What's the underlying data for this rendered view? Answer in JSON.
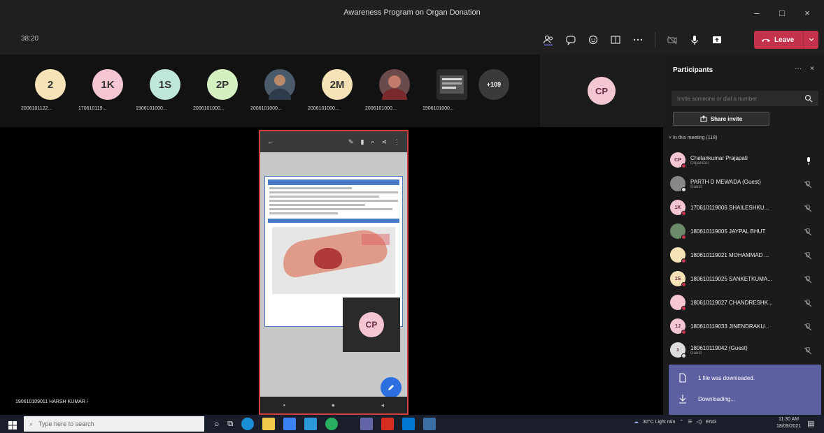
{
  "window": {
    "title": "Awareness Program on Organ Donation",
    "minimize": "–",
    "maximize": "□",
    "close": "×"
  },
  "toolbar": {
    "timer": "38:20",
    "leave_label": "Leave"
  },
  "strip": {
    "tiles": [
      {
        "initials": "2",
        "name": "2006101122...",
        "color": "#f5e2b6"
      },
      {
        "initials": "1K",
        "name": "170610119...",
        "color": "#f4c6d2"
      },
      {
        "initials": "1S",
        "name": "1906101000...",
        "color": "#bfe7d7"
      },
      {
        "initials": "2P",
        "name": "2006101000...",
        "color": "#d4f0c0"
      },
      {
        "initials": "",
        "name": "2006101000...",
        "color": "#4a5a6a"
      },
      {
        "initials": "2M",
        "name": "2006101000...",
        "color": "#f5e2b6"
      },
      {
        "initials": "",
        "name": "2006101000...",
        "color": "#6a4a4a"
      },
      {
        "initials": "",
        "name": "1906101000...",
        "color": "#2a2a2a"
      }
    ],
    "more": "+109",
    "presenter_initials": "CP"
  },
  "stage": {
    "self_initials": "CP",
    "speaker_name": "190610109011 HARSH KUMAR"
  },
  "panel": {
    "title": "Participants",
    "more": "···",
    "close": "×",
    "invite_placeholder": "Invite someone or dial a number",
    "share_label": "Share invite",
    "section_label": "In this meeting (118)",
    "participants": [
      {
        "name": "Chetankumar Prajapati",
        "role": "Organizer",
        "color": "#f4c6d2",
        "initials": "CP"
      },
      {
        "name": "PARTH D MEWADA (Guest)",
        "role": "Guest",
        "color": "#888888",
        "initials": ""
      },
      {
        "name": "170610119006 SHAILESHKU...",
        "role": "",
        "color": "#f4c6d2",
        "initials": "1K"
      },
      {
        "name": "180610119005 JAYPAL BHUT",
        "role": "",
        "color": "#6a8a6a",
        "initials": ""
      },
      {
        "name": "180610119021 MOHAMMAD ...",
        "role": "",
        "color": "#f5e2b6",
        "initials": ""
      },
      {
        "name": "180610119025 SANKETKUMA...",
        "role": "",
        "color": "#f5e2b6",
        "initials": "1S"
      },
      {
        "name": "180610119027 CHANDRESHK...",
        "role": "",
        "color": "#f4c6d2",
        "initials": ""
      },
      {
        "name": "180610119033 JINENDRAKU...",
        "role": "",
        "color": "#f4c6d2",
        "initials": "1J"
      },
      {
        "name": "180610119042 (Guest)",
        "role": "Guest",
        "color": "#dddddd",
        "initials": "1"
      }
    ]
  },
  "toast": {
    "line1": "1 file was downloaded.",
    "line2": "Downloading..."
  },
  "taskbar": {
    "search_placeholder": "Type here to search",
    "weather": "30°C Light rain",
    "lang": "ENG",
    "time": "11:30 AM",
    "date": "18/09/2021"
  }
}
